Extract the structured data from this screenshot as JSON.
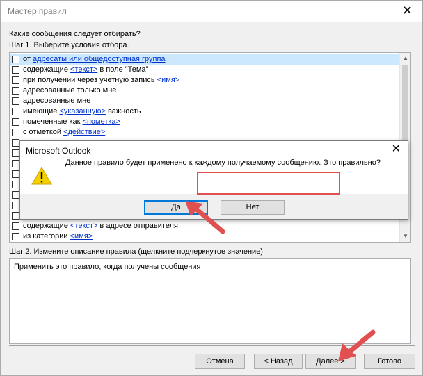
{
  "window": {
    "title": "Мастер правил",
    "close_glyph": "✕"
  },
  "question": "Какие сообщения следует отбирать?",
  "step1_label": "Шаг 1. Выберите условия отбора.",
  "conditions": [
    {
      "pre": "от ",
      "link": "адресаты или общедоступная группа",
      "post": ""
    },
    {
      "pre": "содержащие ",
      "link": "<текст>",
      "post": " в поле \"Тема\""
    },
    {
      "pre": "при получении через учетную запись ",
      "link": "<имя>",
      "post": ""
    },
    {
      "pre": "адресованные только мне",
      "link": "",
      "post": ""
    },
    {
      "pre": "адресованные мне",
      "link": "",
      "post": ""
    },
    {
      "pre": "имеющие ",
      "link": "<указанную>",
      "post": " важность"
    },
    {
      "pre": "помеченные как ",
      "link": "<пометка>",
      "post": ""
    },
    {
      "pre": "с отметкой ",
      "link": "<действие>",
      "post": ""
    },
    {
      "pre": "",
      "link": "",
      "post": ""
    },
    {
      "pre": "",
      "link": "",
      "post": ""
    },
    {
      "pre": "",
      "link": "",
      "post": ""
    },
    {
      "pre": "",
      "link": "",
      "post": ""
    },
    {
      "pre": "",
      "link": "",
      "post": ""
    },
    {
      "pre": "",
      "link": "",
      "post": ""
    },
    {
      "pre": "",
      "link": "",
      "post": ""
    },
    {
      "pre": "",
      "link": "",
      "post": ""
    },
    {
      "pre": "содержащие ",
      "link": "<текст>",
      "post": " в адресе отправителя"
    },
    {
      "pre": "из категории ",
      "link": "<имя>",
      "post": ""
    }
  ],
  "step2_label": "Шаг 2. Измените описание правила (щелкните подчеркнутое значение).",
  "rule_description": "Применить это правило, когда получены сообщения",
  "buttons": {
    "cancel": "Отмена",
    "back": "< Назад",
    "next": "Далее >",
    "finish": "Готово"
  },
  "dialog": {
    "title": "Microsoft Outlook",
    "close_glyph": "✕",
    "message": "Данное правило будет применено к каждому получаемому сообщению. Это правильно?",
    "yes": "Да",
    "no": "Нет"
  },
  "colors": {
    "link": "#0033cc",
    "selection": "#cce8ff",
    "annotation": "#e05050",
    "primary_border": "#0078d7"
  },
  "icons": {
    "warning": "warning-icon",
    "scroll_up": "scroll-up-icon",
    "scroll_down": "scroll-down-icon"
  }
}
